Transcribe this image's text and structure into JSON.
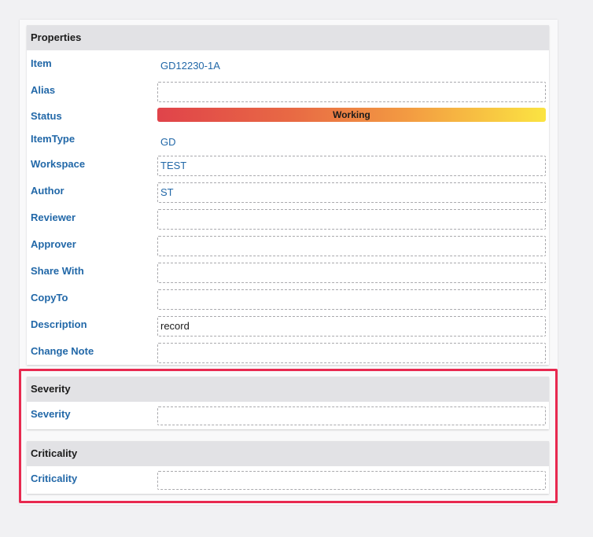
{
  "properties": {
    "header": "Properties",
    "item": {
      "label": "Item",
      "value": "GD12230-1A"
    },
    "alias": {
      "label": "Alias",
      "value": ""
    },
    "status": {
      "label": "Status",
      "value": "Working"
    },
    "itemtype": {
      "label": "ItemType",
      "value": "GD"
    },
    "workspace": {
      "label": "Workspace",
      "value": "TEST"
    },
    "author": {
      "label": "Author",
      "value": "ST"
    },
    "reviewer": {
      "label": "Reviewer",
      "value": ""
    },
    "approver": {
      "label": "Approver",
      "value": ""
    },
    "share_with": {
      "label": "Share With",
      "value": ""
    },
    "copy_to": {
      "label": "CopyTo",
      "value": ""
    },
    "description": {
      "label": "Description",
      "value": "record"
    },
    "change_note": {
      "label": "Change Note",
      "value": ""
    }
  },
  "severity": {
    "header": "Severity",
    "field": {
      "label": "Severity",
      "value": ""
    }
  },
  "criticality": {
    "header": "Criticality",
    "field": {
      "label": "Criticality",
      "value": ""
    }
  },
  "colors": {
    "label_blue": "#2268a8",
    "highlight_border": "#e8294f",
    "status_gradient_start": "#e0434a",
    "status_gradient_end": "#fbe442"
  }
}
